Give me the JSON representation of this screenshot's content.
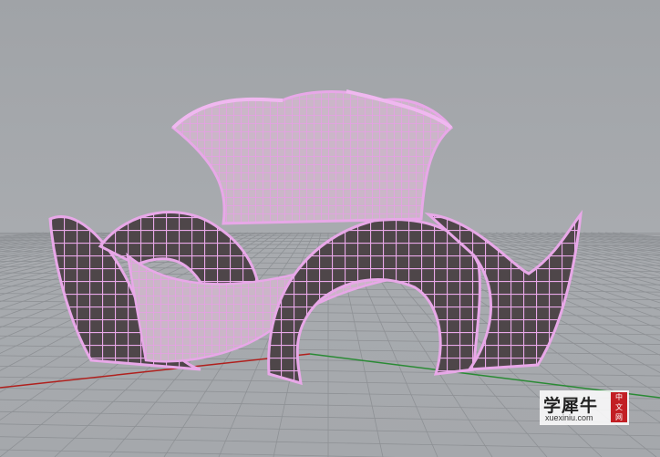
{
  "viewport": {
    "background": "#a4a7ab",
    "grid_color": "#8e9195",
    "x_axis_color": "#b0201d",
    "y_axis_color": "#2a8a35",
    "wire_color": "#e8a8e8",
    "surface_color": "#4e4649"
  },
  "watermark": {
    "title": "学犀牛",
    "url": "xuexiniu.com",
    "seal": "中文网"
  }
}
